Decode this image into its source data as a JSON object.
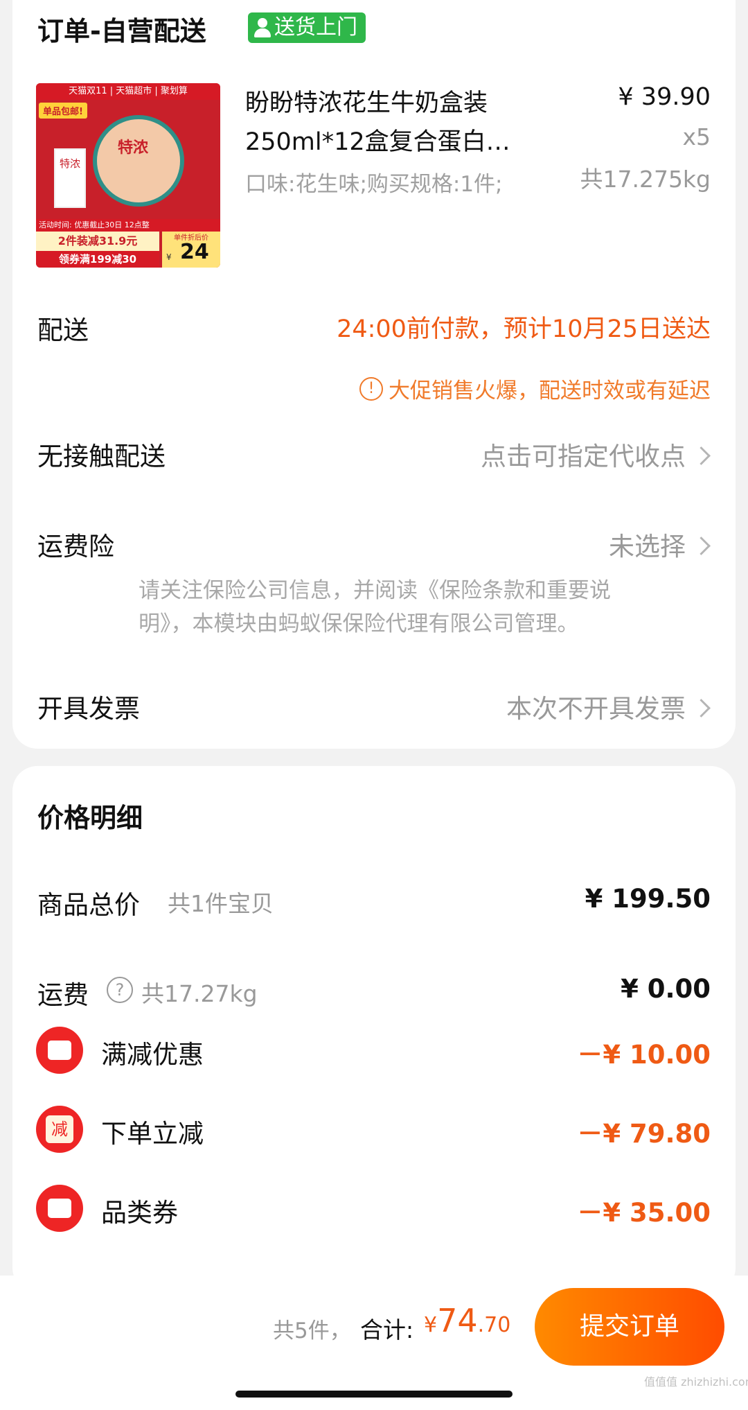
{
  "order": {
    "title": "订单-自营配送",
    "badge": "送货上门",
    "product": {
      "name_line1": "盼盼特浓花生牛奶盒装",
      "name_line2": "250ml*12盒复合蛋白…",
      "spec": "口味:花生味;购买规格:1件;",
      "price": "¥ 39.90",
      "qty": "x5",
      "weight": "共17.275kg",
      "image": {
        "top_banner": "天猫双11 | 天猫超市 | 聚划算",
        "corner_tag": "单品包邮!",
        "brand_text": "特浓",
        "promo_line1": "活动时间: 优惠截止30日 12点整",
        "promo_line2": "2件装减31.9元",
        "promo_line3": "领券满199减30",
        "price_tag_label": "单件折后价",
        "price_tag_currency": "¥",
        "price_tag_value": "24"
      }
    },
    "delivery_label": "配送",
    "delivery_value": "24:00前付款，预计10月25日送达",
    "delay_notice": "大促销售火爆，配送时效或有延迟",
    "contactless_label": "无接触配送",
    "contactless_value": "点击可指定代收点",
    "insurance_label": "运费险",
    "insurance_value": "未选择",
    "insurance_note_line1": "请关注保险公司信息，并阅读《保险条款和重要说",
    "insurance_note_line2": "明》，本模块由蚂蚁保保险代理有限公司管理。",
    "invoice_label": "开具发票",
    "invoice_value": "本次不开具发票"
  },
  "price": {
    "title": "价格明细",
    "goods_label": "商品总价",
    "goods_sub": "共1件宝贝",
    "goods_value": "¥ 199.50",
    "shipping_label": "运费",
    "shipping_sub": "共17.27kg",
    "shipping_value": "¥ 0.00",
    "discounts": [
      {
        "label": "满减优惠",
        "value": "－¥ 10.00"
      },
      {
        "label": "下单立减",
        "value": "－¥ 79.80",
        "icon_char": "减"
      },
      {
        "label": "品类券",
        "value": "－¥ 35.00"
      }
    ]
  },
  "bottom": {
    "count": "共5件，",
    "total_label": "合计:",
    "currency": "¥",
    "total_int": "74",
    "total_dec": ".70",
    "submit": "提交订单"
  },
  "watermark": "值值值 zhizhizhi.com",
  "colors": {
    "accent": "#ef5a14",
    "badge_green": "#2fb74a",
    "submit": "#ff6a00"
  }
}
